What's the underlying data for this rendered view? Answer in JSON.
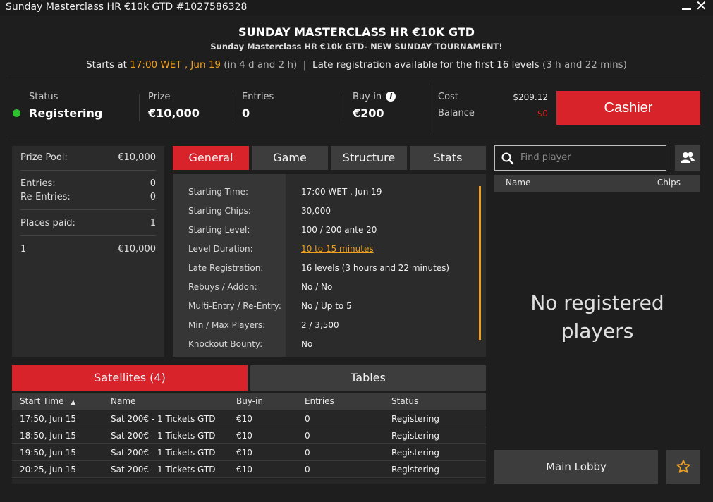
{
  "window": {
    "title": "Sunday Masterclass HR €10k GTD #1027586328"
  },
  "header": {
    "title": "SUNDAY MASTERCLASS HR €10K GTD",
    "subtitle": "Sunday Masterclass HR €10k GTD- NEW SUNDAY TOURNAMENT!",
    "starts_prefix": "Starts at",
    "starts_time": "17:00 WET , Jun 19",
    "starts_in": "(in 4 d and 2 h)",
    "separator": "|",
    "late_reg_text": "Late registration available for the first 16 levels",
    "late_reg_duration": "(3 h and 22 mins)"
  },
  "stats": {
    "status_label": "Status",
    "status_value": "Registering",
    "prize_label": "Prize",
    "prize_value": "€10,000",
    "entries_label": "Entries",
    "entries_value": "0",
    "buyin_label": "Buy-in",
    "buyin_value": "€200",
    "cost_label": "Cost",
    "cost_value": "$209.12",
    "balance_label": "Balance",
    "balance_value": "$0",
    "cashier_label": "Cashier",
    "status_color": "#2ec22e",
    "accent_color": "#d9232a",
    "highlight_color": "#f0a020"
  },
  "prize_panel": {
    "prize_pool_label": "Prize Pool:",
    "prize_pool_value": "€10,000",
    "entries_label": "Entries:",
    "entries_value": "0",
    "reentries_label": "Re-Entries:",
    "reentries_value": "0",
    "places_paid_label": "Places paid:",
    "places_paid_value": "1",
    "payouts": [
      {
        "place": "1",
        "amount": "€10,000"
      }
    ]
  },
  "tabs": [
    {
      "label": "General",
      "active": true
    },
    {
      "label": "Game",
      "active": false
    },
    {
      "label": "Structure",
      "active": false
    },
    {
      "label": "Stats",
      "active": false
    }
  ],
  "general": [
    {
      "label": "Starting Time:",
      "value": "17:00 WET , Jun 19"
    },
    {
      "label": "Starting Chips:",
      "value": "30,000"
    },
    {
      "label": "Starting Level:",
      "value": "100 / 200 ante 20"
    },
    {
      "label": "Level Duration:",
      "value": "10 to 15 minutes",
      "link": true
    },
    {
      "label": "Late Registration:",
      "value": "16 levels (3 hours and 22 minutes)"
    },
    {
      "label": "Rebuys / Addon:",
      "value": "No / No"
    },
    {
      "label": "Multi-Entry / Re-Entry:",
      "value": "No / Up to 5"
    },
    {
      "label": "Min / Max Players:",
      "value": "2 / 3,500"
    },
    {
      "label": "Knockout Bounty:",
      "value": "No"
    }
  ],
  "bottom_tabs": {
    "satellites": "Satellites (4)",
    "tables": "Tables"
  },
  "satellites_table": {
    "columns": [
      "Start Time",
      "Name",
      "Buy-in",
      "Entries",
      "Status"
    ],
    "sort_indicator": "▲",
    "rows": [
      [
        "17:50, Jun 15",
        "Sat 200€ - 1 Tickets GTD",
        "€10",
        "0",
        "Registering"
      ],
      [
        "18:50, Jun 15",
        "Sat 200€ - 1 Tickets GTD",
        "€10",
        "0",
        "Registering"
      ],
      [
        "19:50, Jun 15",
        "Sat 200€ - 1 Tickets GTD",
        "€10",
        "0",
        "Registering"
      ],
      [
        "20:25, Jun 15",
        "Sat 200€ - 1 Tickets GTD",
        "€10",
        "0",
        "Registering"
      ]
    ]
  },
  "players_panel": {
    "search_placeholder": "Find player",
    "col_name": "Name",
    "col_chips": "Chips",
    "empty_line1": "No registered",
    "empty_line2": "players",
    "main_lobby_label": "Main Lobby",
    "icons": {
      "search": "search-icon",
      "users": "users-icon",
      "favorite": "star-icon"
    }
  }
}
